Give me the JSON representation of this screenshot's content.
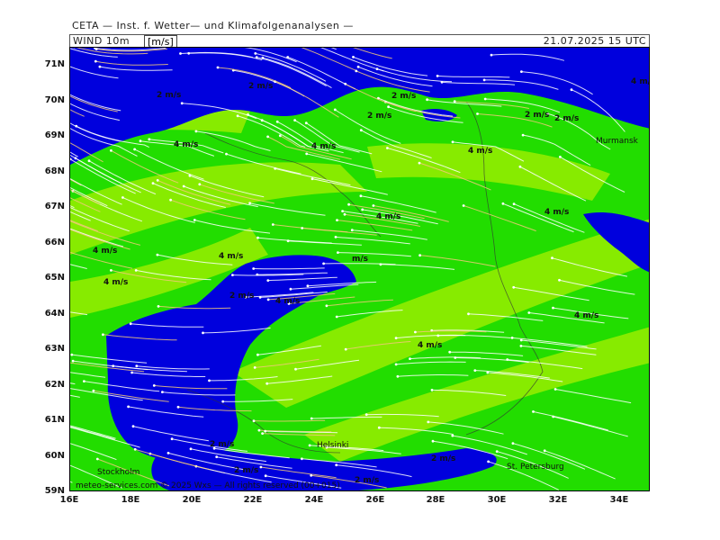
{
  "header": {
    "provider": "CETA — Inst. f. Wetter— und Klimafolgenanalysen —",
    "variable": "WIND 10m",
    "unit": "[m/s]",
    "valid_time": "21.07.2025  15 UTC"
  },
  "axes": {
    "lat_labels": [
      "71N",
      "70N",
      "69N",
      "68N",
      "67N",
      "66N",
      "65N",
      "64N",
      "63N",
      "62N",
      "61N",
      "60N",
      "59N"
    ],
    "lon_labels": [
      "16E",
      "18E",
      "20E",
      "22E",
      "24E",
      "26E",
      "28E",
      "30E",
      "32E",
      "34E"
    ]
  },
  "annotations": {
    "speed_labels": [
      "2 m/s",
      "2 m/s",
      "2 m/s",
      "2 m/s",
      "4 m/s",
      "4 m/s",
      "4 m/s",
      "4 m/s",
      "4 m/s",
      "4 m/s",
      "4 m/s",
      "4 m/s",
      "2 m/s",
      "4 m/s",
      "4 m/s",
      "4 m/s",
      "2 m/s",
      "m/s",
      "2 m/s",
      "2 m/s",
      "2 m/s",
      "2 m/s",
      "2 m/s",
      "4 m/s"
    ],
    "cities": [
      "Murmansk",
      "Helsinki",
      "St. Petersburg",
      "Stockholm"
    ]
  },
  "footer": {
    "credit": "meteo-services.com © 2025 Wxs — All rights reserved (00+015)"
  },
  "colors": {
    "calm": "#0000dd",
    "moderate": "#22dd00",
    "strong": "#99ee00",
    "streamline": "#ffffff",
    "streamline_alt": "#f2c87a"
  }
}
